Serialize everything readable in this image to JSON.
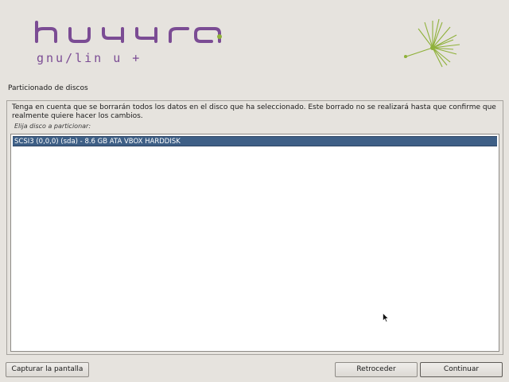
{
  "branding": {
    "logo_primary": "huayra",
    "logo_secondary": "gnu/lin u +",
    "logo_color": "#7b4c94",
    "accent_color": "#8fb13a"
  },
  "page": {
    "title": "Particionado de discos",
    "description": "Tenga en cuenta que se borrarán todos los datos en el disco que ha seleccionado. Este borrado no se realizará hasta que confirme que realmente quiere hacer los cambios.",
    "prompt": "Elija disco a particionar:"
  },
  "disks": [
    {
      "label": "SCSI3 (0,0,0) (sda) - 8.6 GB ATA VBOX HARDDISK",
      "selected": true
    }
  ],
  "buttons": {
    "screenshot": "Capturar la pantalla",
    "back": "Retroceder",
    "continue": "Continuar"
  },
  "colors": {
    "selection_bg": "#3e5f86",
    "window_bg": "#e6e3de"
  }
}
